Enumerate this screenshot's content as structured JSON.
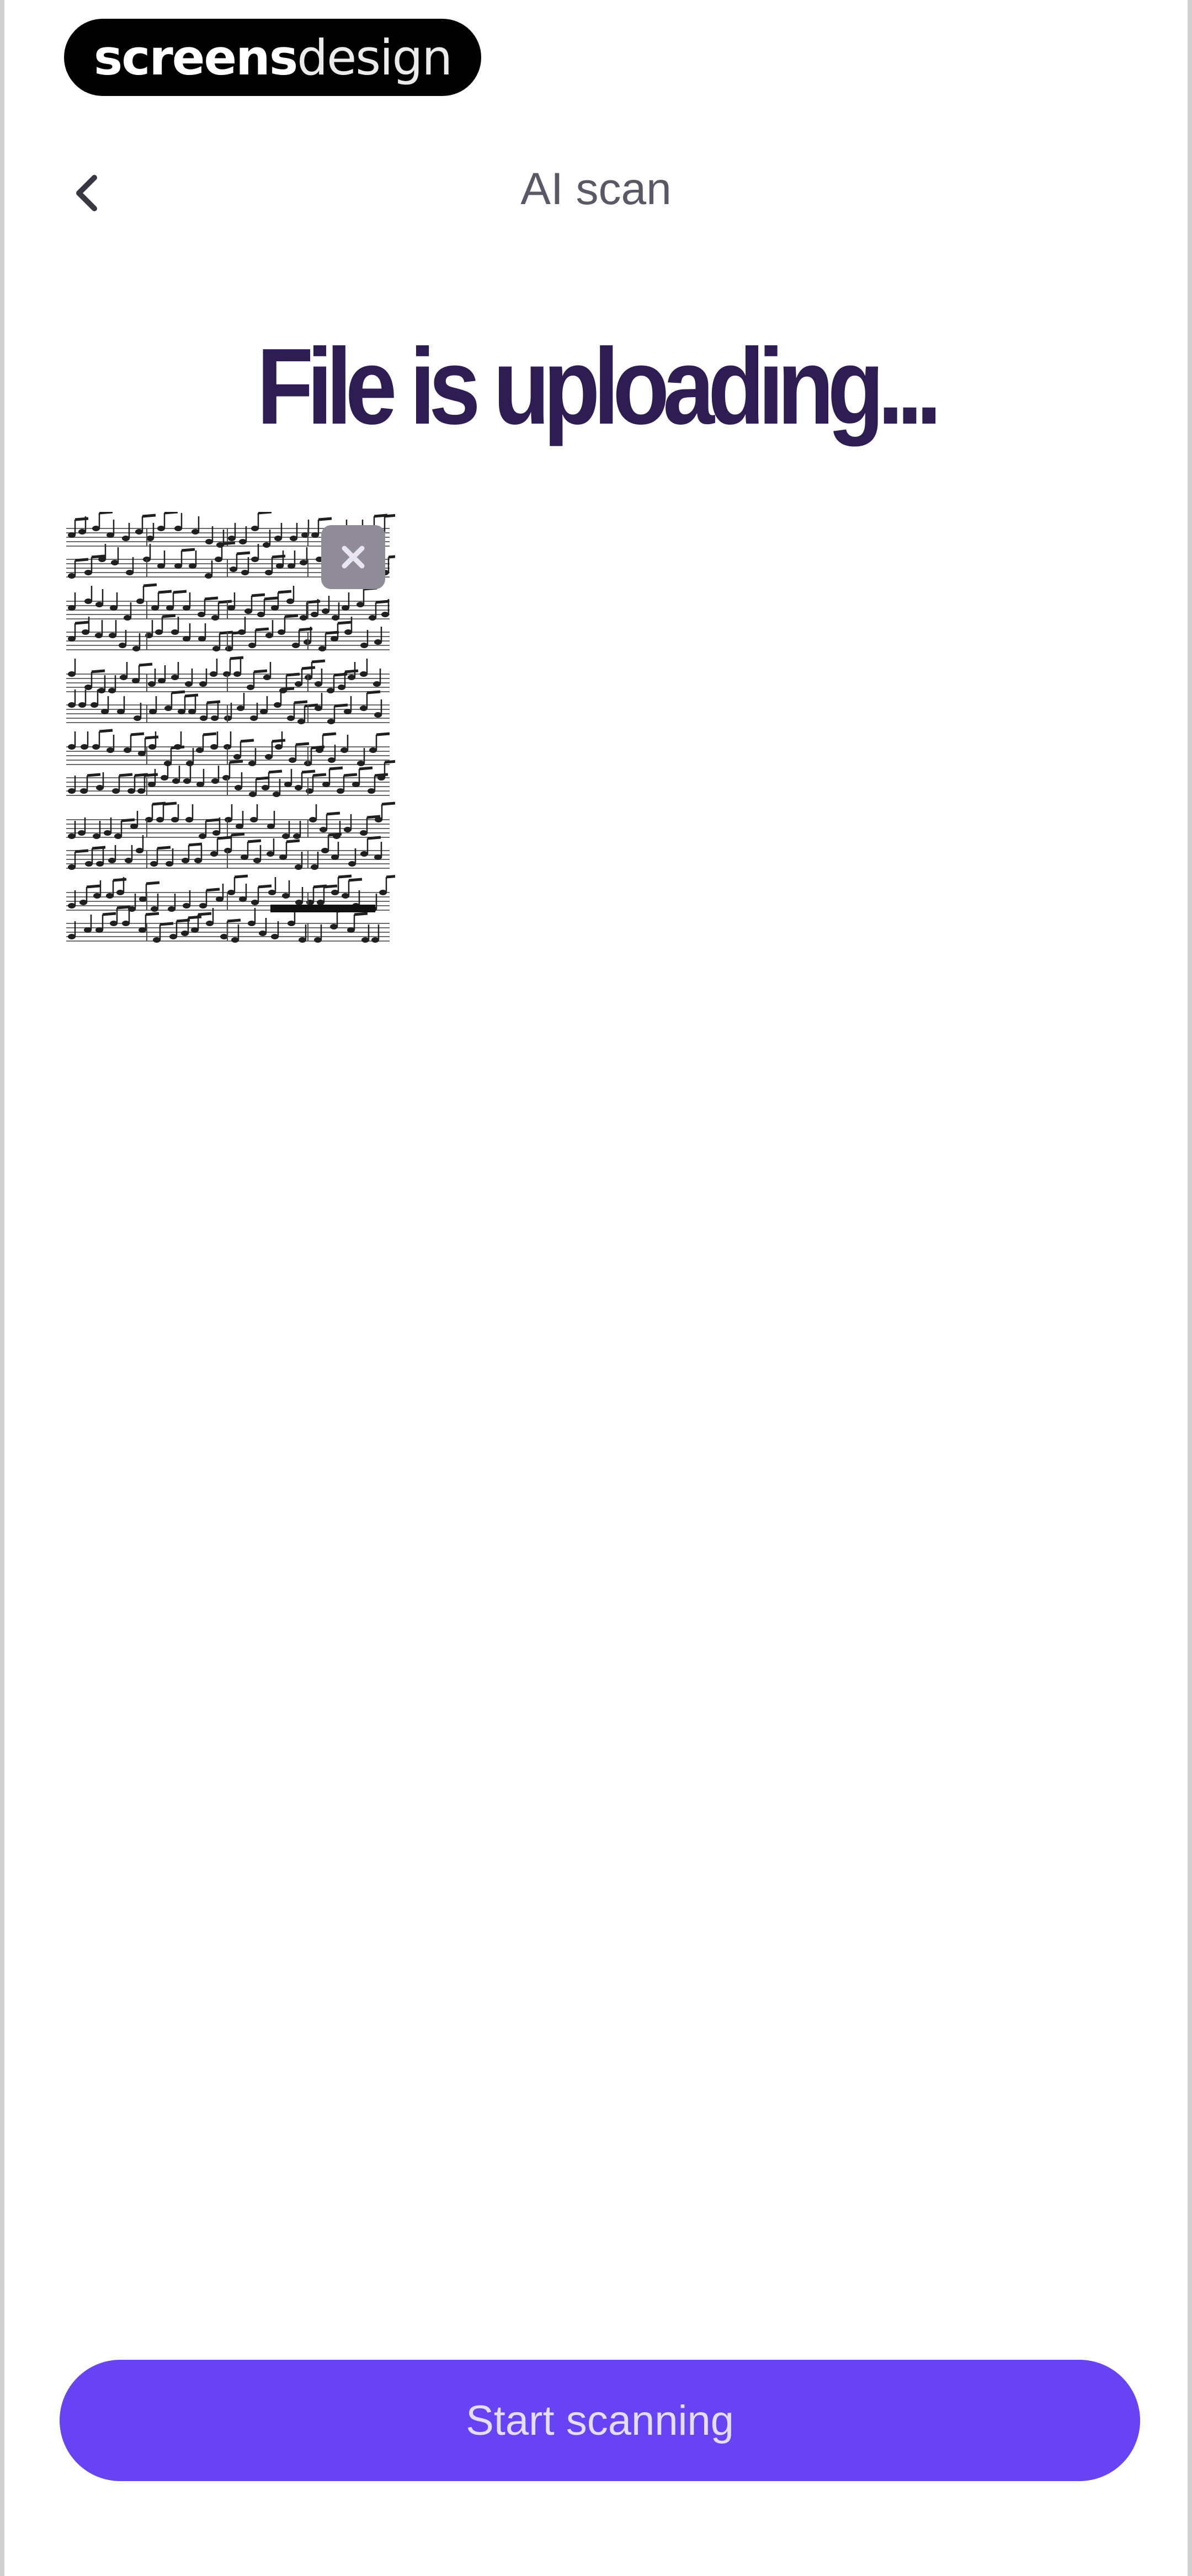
{
  "watermark": {
    "bold": "screens",
    "light": "design"
  },
  "header": {
    "title": "AI scan",
    "back_icon": "chevron-left-icon"
  },
  "main": {
    "heading": "File is uploading...",
    "file": {
      "thumbnail_icon": "sheet-music-thumbnail",
      "remove_icon": "close-icon"
    }
  },
  "footer": {
    "primary_label": "Start scanning"
  },
  "colors": {
    "accent": "#6644f4",
    "heading": "#2e1d52",
    "button_text": "#e4ddff"
  }
}
